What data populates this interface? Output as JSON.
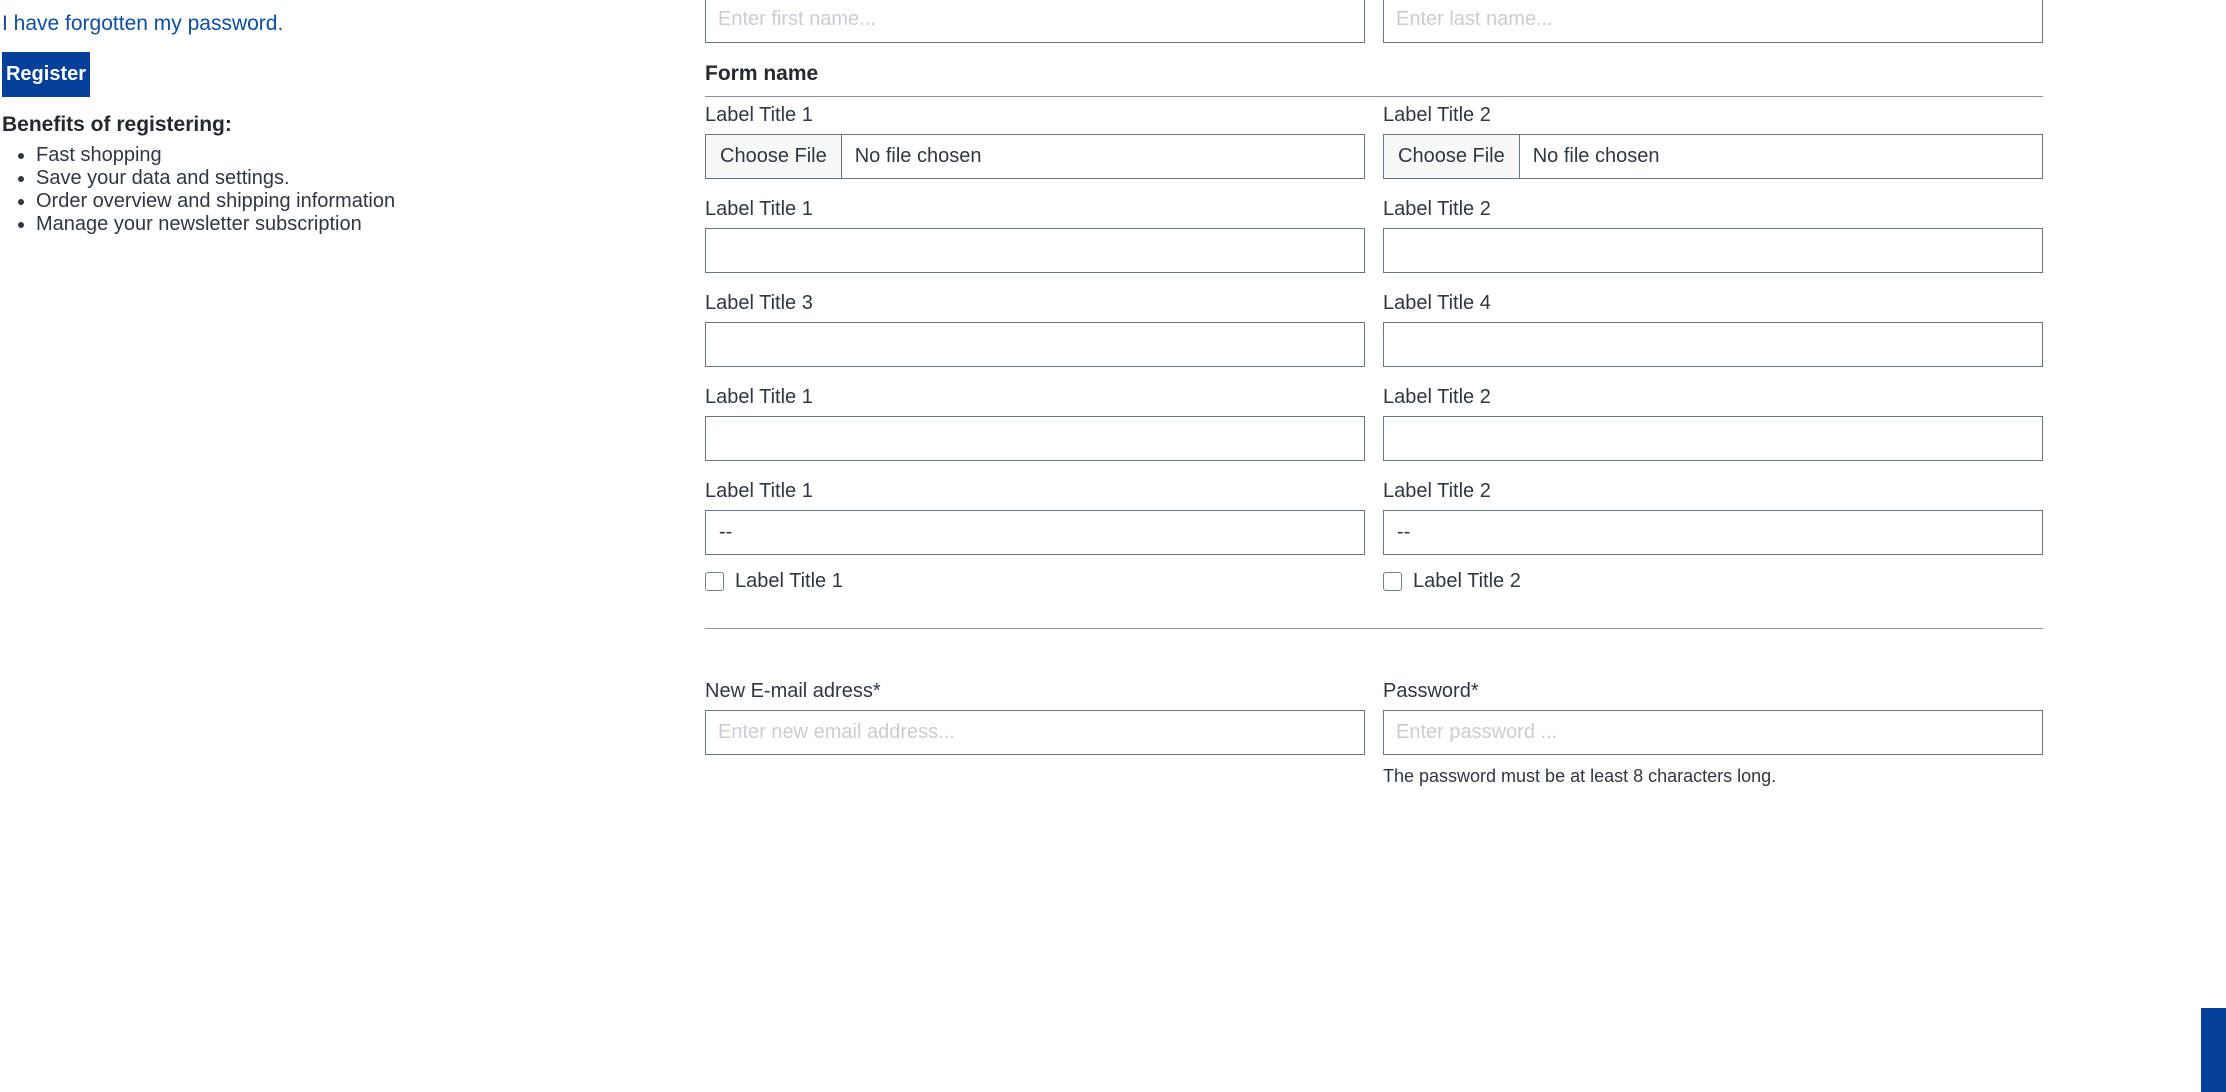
{
  "sidebar": {
    "forgot_password_link": "I have forgotten my password.",
    "register_button": "Register",
    "benefits_heading": "Benefits of registering:",
    "benefits": [
      "Fast shopping",
      "Save your data and settings.",
      "Order overview and shipping information",
      "Manage your newsletter subscription"
    ]
  },
  "form": {
    "name_row": {
      "first_name": {
        "value": "",
        "placeholder": "Enter first name..."
      },
      "last_name": {
        "value": "",
        "placeholder": "Enter last name..."
      }
    },
    "section_heading": "Form name",
    "file_row": {
      "left": {
        "label": "Label Title 1",
        "button_label": "Choose File",
        "status": "No file chosen"
      },
      "right": {
        "label": "Label Title 2",
        "button_label": "Choose File",
        "status": "No file chosen"
      }
    },
    "row_a": {
      "left": {
        "label": "Label Title 1",
        "value": "",
        "placeholder": ""
      },
      "right": {
        "label": "Label Title 2",
        "value": "",
        "placeholder": ""
      }
    },
    "row_b": {
      "left": {
        "label": "Label Title 3",
        "value": "",
        "placeholder": ""
      },
      "right": {
        "label": "Label Title 4",
        "value": "",
        "placeholder": ""
      }
    },
    "row_c": {
      "left": {
        "label": "Label Title 1",
        "value": "",
        "placeholder": ""
      },
      "right": {
        "label": "Label Title 2",
        "value": "",
        "placeholder": ""
      }
    },
    "row_d": {
      "left": {
        "label": "Label Title 1",
        "selected": "--"
      },
      "right": {
        "label": "Label Title 2",
        "selected": "--"
      }
    },
    "checkbox_row": {
      "left": {
        "label": "Label Title 1",
        "checked": false
      },
      "right": {
        "label": "Label Title 2",
        "checked": false
      }
    },
    "credentials": {
      "email": {
        "label": "New E-mail adress*",
        "value": "",
        "placeholder": "Enter new email address..."
      },
      "password": {
        "label": "Password*",
        "value": "",
        "placeholder": "Enter password ...",
        "hint": "The password must be at least 8 characters long."
      }
    }
  },
  "colors": {
    "brand_blue": "#044099",
    "link_blue": "#0b4ea2",
    "input_border": "#6a7485",
    "rule": "#8a929e",
    "text": "#2f3742",
    "placeholder": "#c9cdd3",
    "file_button_bg": "#f7f8f8"
  }
}
